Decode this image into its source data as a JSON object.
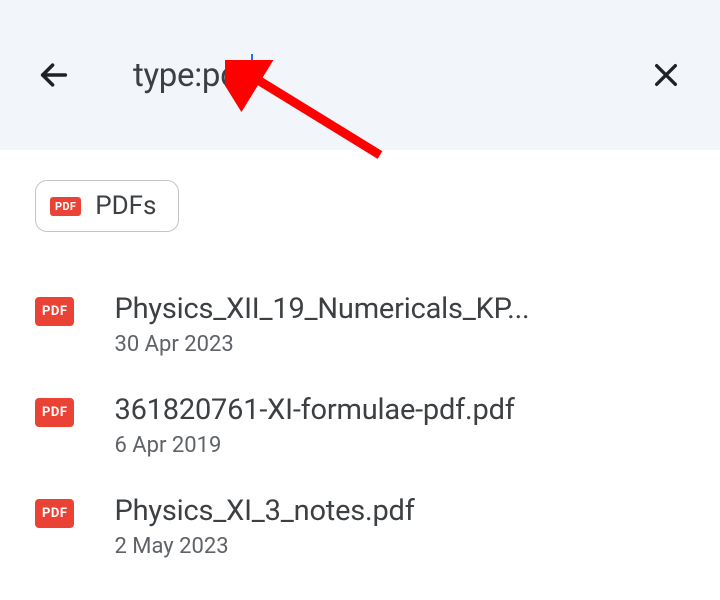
{
  "search": {
    "query": "type:pdf"
  },
  "filter": {
    "badge": "PDF",
    "label": "PDFs"
  },
  "results": [
    {
      "icon": "PDF",
      "title": "Physics_XII_19_Numericals_KP...",
      "date": "30 Apr 2023"
    },
    {
      "icon": "PDF",
      "title": "361820761-XI-formulae-pdf.pdf",
      "date": "6 Apr 2019"
    },
    {
      "icon": "PDF",
      "title": "Physics_XI_3_notes.pdf",
      "date": "2 May 2023"
    }
  ]
}
